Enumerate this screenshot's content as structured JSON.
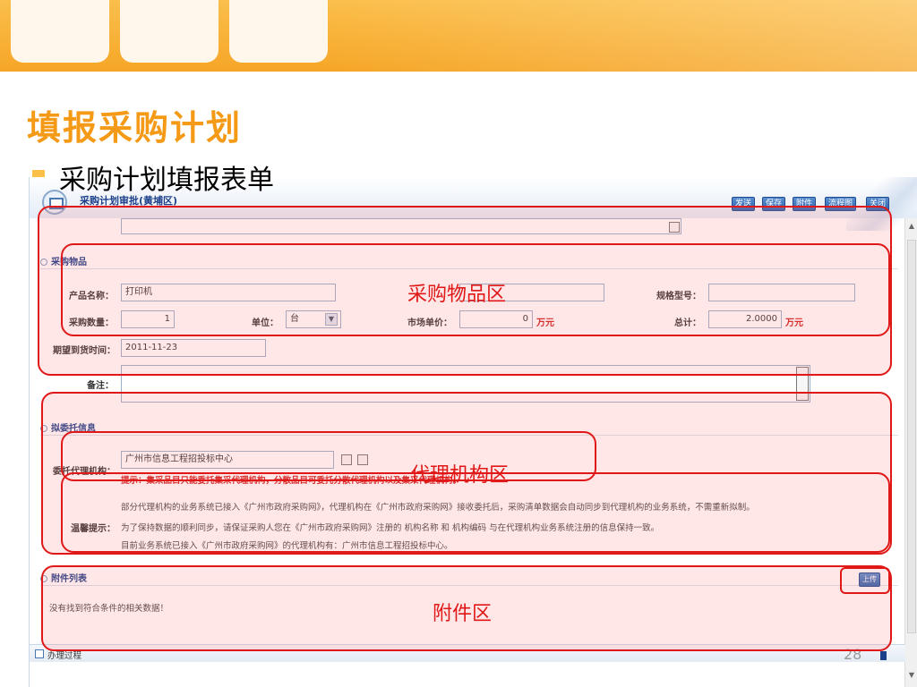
{
  "slide": {
    "title": "填报采购计划",
    "bullet": "采购计划填报表单",
    "page_number": "28"
  },
  "form": {
    "header_title": "采购计划审批(黄埔区)",
    "buttons": [
      "发送",
      "保存",
      "附件",
      "流程图",
      "关闭"
    ],
    "purchase_section": "采购物品",
    "product_name_label": "产品名称：",
    "product_name_value": "打印机",
    "spec_label": "规格型号：",
    "spec_value": "",
    "quantity_label": "采购数量：",
    "quantity_value": "1",
    "unit_label": "单位：",
    "unit_value": "台",
    "market_price_label": "市场单价：",
    "market_price_value": "0",
    "market_price_unit": "万元",
    "total_label": "总计：",
    "total_value": "2.0000",
    "total_unit": "万元",
    "delivery_label": "期望到货时间：",
    "delivery_value": "2011-11-23",
    "remarks_label": "备注：",
    "agency_section": "拟委托信息",
    "agency_label": "委托代理机构：",
    "agency_value": "广州市信息工程招投标中心",
    "agency_tip": "提示：集采品目只能委托集采代理机构，分散品目可委托分散代理机构以及集采代理机构。",
    "warm_tip_label": "温馨提示：",
    "warm_tips": [
      "部分代理机构的业务系统已接入《广州市政府采购网》，代理机构在《广州市政府采购网》接收委托后，采购清单数据会自动同步到代理机构的业务系统，不需重新拟制。",
      "为了保持数据的顺利同步，请保证采购人您在《广州市政府采购网》注册的 机构名称 和 机构编码 与在代理机构业务系统注册的信息保持一致。",
      "目前业务系统已接入《广州市政府采购网》的代理机构有：广州市信息工程招投标中心。"
    ],
    "attachment_section": "附件列表",
    "upload_button": "上传",
    "no_data": "没有找到符合条件的相关数据！",
    "process_label": "办理过程"
  },
  "annotations": {
    "purchase_area": "采购物品区",
    "agency_area": "代理机构区",
    "attachment_area": "附件区"
  },
  "colors": {
    "title": "#f59a16",
    "highlight": "#e01818",
    "band": "#fbbf4c",
    "form_accent": "#1c3f8a"
  }
}
